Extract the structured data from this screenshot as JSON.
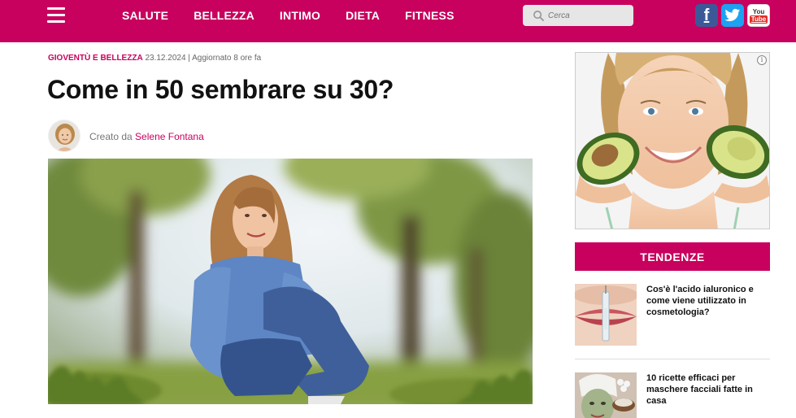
{
  "header": {
    "nav": [
      "SALUTE",
      "BELLEZZA",
      "INTIMO",
      "DIETA",
      "FITNESS"
    ],
    "search_placeholder": "Cerca",
    "social": {
      "facebook": "f",
      "youtube_you": "You",
      "youtube_tube": "Tube"
    },
    "brand_color": "#c8005e"
  },
  "article": {
    "category": "GIOVENTÙ E BELLEZZA",
    "date": "23.12.2024",
    "updated": "| Aggiornato 8 ore fa",
    "title": "Come in 50 sembrare su 30?",
    "author_prefix": "Creato da",
    "author_name": "Selene Fontana"
  },
  "sidebar": {
    "ad_info": "i",
    "trends_title": "TENDENZE",
    "trends": [
      {
        "title": "Cos'è l'acido ialuronico e come viene utilizzato in cosmetologia?"
      },
      {
        "title": "10 ricette efficaci per maschere facciali fatte in casa"
      }
    ]
  }
}
